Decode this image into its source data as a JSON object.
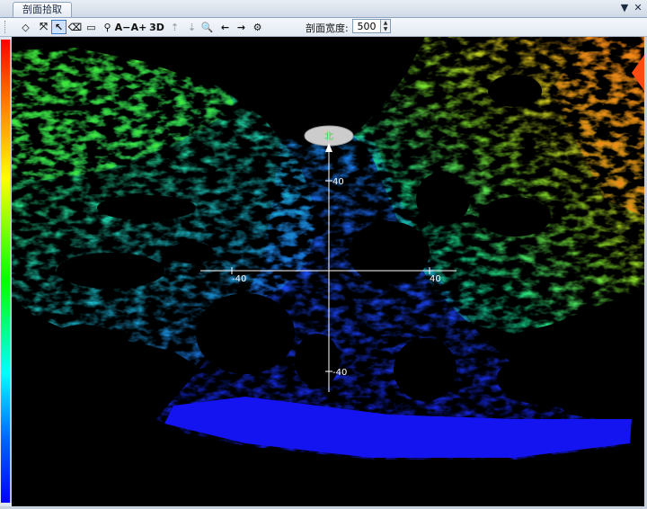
{
  "window": {
    "tab_title": "剖面拾取",
    "dropdown_glyph": "▼",
    "close_glyph": "✕"
  },
  "toolbar": {
    "buttons": [
      {
        "name": "select-polygon-icon",
        "glyph": "◇"
      },
      {
        "name": "fit-extent-icon",
        "glyph": "⤧"
      },
      {
        "name": "pointer-select-icon",
        "glyph": "↖",
        "active": true
      },
      {
        "name": "eraser-icon",
        "glyph": "⌫"
      },
      {
        "name": "rectangle-select-icon",
        "glyph": "▭"
      },
      {
        "name": "pan-icon",
        "glyph": "⚲"
      },
      {
        "name": "font-decrease-icon",
        "glyph": "A−"
      },
      {
        "name": "font-increase-icon",
        "glyph": "A+"
      },
      {
        "name": "view-3d-icon",
        "glyph": "3D"
      },
      {
        "name": "layer-up-icon",
        "glyph": "⇡",
        "disabled": true
      },
      {
        "name": "layer-down-icon",
        "glyph": "⇣",
        "disabled": true
      },
      {
        "name": "zoom-icon",
        "glyph": "🔍"
      },
      {
        "name": "arrow-left-icon",
        "glyph": "←"
      },
      {
        "name": "arrow-right-icon",
        "glyph": "→"
      },
      {
        "name": "settings-icon",
        "glyph": "⚙"
      }
    ],
    "width_label": "剖面宽度:",
    "width_value": "500"
  },
  "scene": {
    "colors": {
      "background": "#000000",
      "axis": "#ffffff",
      "north_label": "#39d84a",
      "north_marker": "#cccccc"
    },
    "north_label": "北",
    "axis_labels": {
      "y_top": "40",
      "y_bottom": "-40",
      "x_left": "-40",
      "x_right": "40"
    }
  },
  "colorbar": {
    "colors": [
      "#ff0000",
      "#ff8800",
      "#ffff00",
      "#00ff00",
      "#00ffff",
      "#0066ff",
      "#0000ff"
    ]
  }
}
